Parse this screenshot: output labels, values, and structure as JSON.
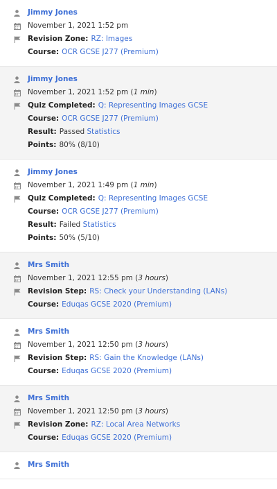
{
  "labels": {
    "revision_zone": "Revision Zone:",
    "revision_step": "Revision Step:",
    "quiz_completed": "Quiz Completed:",
    "course": "Course:",
    "result": "Result:",
    "points": "Points:",
    "statistics": "Statistics"
  },
  "icons": {
    "user": "user-icon",
    "calendar": "calendar-icon",
    "flag": "flag-icon"
  },
  "colors": {
    "link": "#3d6fd6",
    "shaded_bg": "#f4f4f4"
  },
  "entries": [
    {
      "user": "Jimmy Jones",
      "datetime": "November 1, 2021 1:52 pm",
      "duration": "",
      "activity_label": "Revision Zone:",
      "activity_link": "RZ: Images",
      "course": "OCR GCSE J277 (Premium)"
    },
    {
      "user": "Jimmy Jones",
      "datetime": "November 1, 2021 1:52 pm",
      "duration": "1 min",
      "activity_label": "Quiz Completed:",
      "activity_link": "Q: Representing Images GCSE",
      "course": "OCR GCSE J277 (Premium)",
      "result": "Passed",
      "points": "80% (8/10)"
    },
    {
      "user": "Jimmy Jones",
      "datetime": "November 1, 2021 1:49 pm",
      "duration": "1 min",
      "activity_label": "Quiz Completed:",
      "activity_link": "Q: Representing Images GCSE",
      "course": "OCR GCSE J277 (Premium)",
      "result": "Failed",
      "points": "50% (5/10)"
    },
    {
      "user": "Mrs Smith",
      "datetime": "November 1, 2021 12:55 pm",
      "duration": "3 hours",
      "activity_label": "Revision Step:",
      "activity_link": "RS: Check your Understanding (LANs)",
      "course": "Eduqas GCSE 2020 (Premium)"
    },
    {
      "user": "Mrs Smith",
      "datetime": "November 1, 2021 12:50 pm",
      "duration": "3 hours",
      "activity_label": "Revision Step:",
      "activity_link": "RS: Gain the Knowledge (LANs)",
      "course": "Eduqas GCSE 2020 (Premium)"
    },
    {
      "user": "Mrs Smith",
      "datetime": "November 1, 2021 12:50 pm",
      "duration": "3 hours",
      "activity_label": "Revision Zone:",
      "activity_link": "RZ: Local Area Networks",
      "course": "Eduqas GCSE 2020 (Premium)"
    },
    {
      "user": "Mrs Smith"
    }
  ]
}
